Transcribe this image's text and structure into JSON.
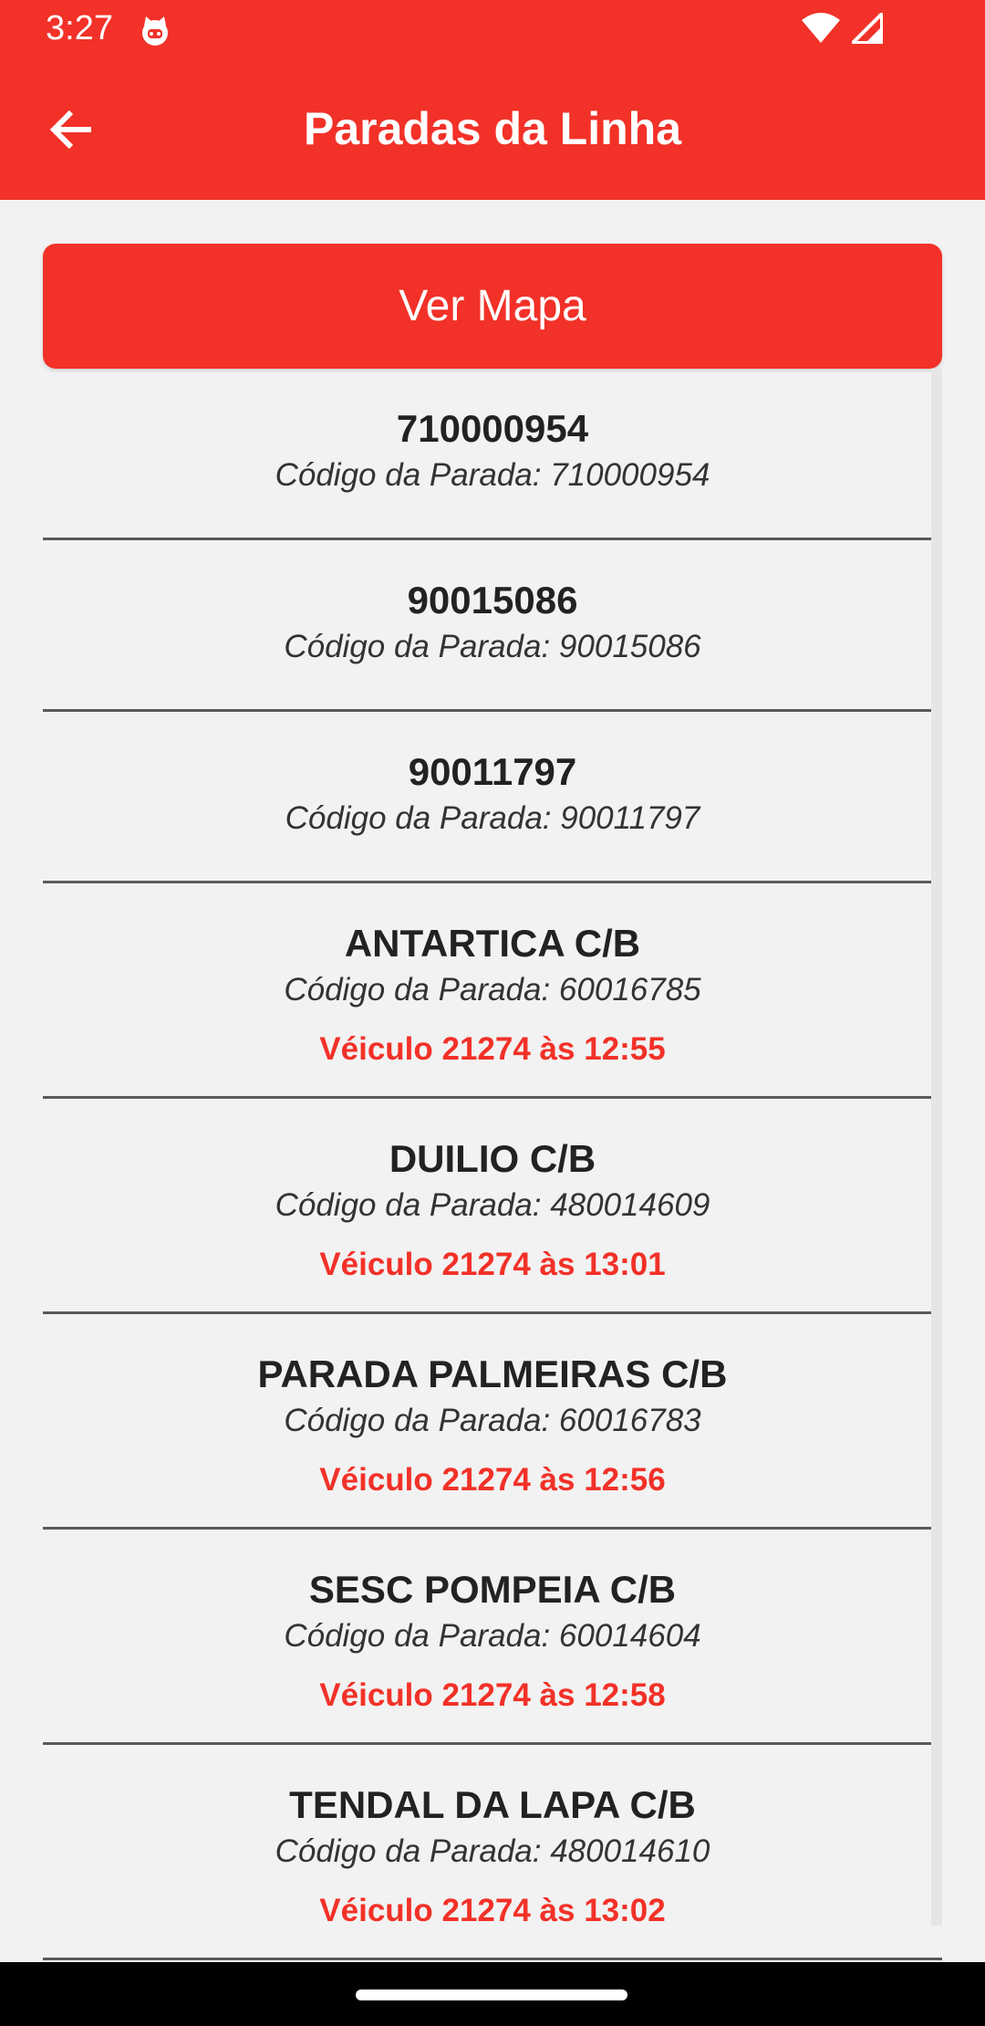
{
  "status_bar": {
    "time": "3:27"
  },
  "app_bar": {
    "title": "Paradas da Linha"
  },
  "map_button": {
    "label": "Ver Mapa"
  },
  "stops": [
    {
      "name": "710000954",
      "code": "Código da Parada: 710000954",
      "vehicle": ""
    },
    {
      "name": "90015086",
      "code": "Código da Parada: 90015086",
      "vehicle": ""
    },
    {
      "name": "90011797",
      "code": "Código da Parada: 90011797",
      "vehicle": ""
    },
    {
      "name": "ANTARTICA C/B",
      "code": "Código da Parada: 60016785",
      "vehicle": "Véiculo 21274 às 12:55"
    },
    {
      "name": "DUILIO C/B",
      "code": "Código da Parada: 480014609",
      "vehicle": "Véiculo 21274 às 13:01"
    },
    {
      "name": "PARADA PALMEIRAS C/B",
      "code": "Código da Parada: 60016783",
      "vehicle": "Véiculo 21274 às 12:56"
    },
    {
      "name": "SESC POMPEIA C/B",
      "code": "Código da Parada: 60014604",
      "vehicle": "Véiculo 21274 às 12:58"
    },
    {
      "name": "TENDAL DA LAPA C/B",
      "code": "Código da Parada: 480014610",
      "vehicle": "Véiculo 21274 às 13:02"
    }
  ],
  "colors": {
    "accent": "#F23128",
    "background": "#F2F2F2"
  }
}
